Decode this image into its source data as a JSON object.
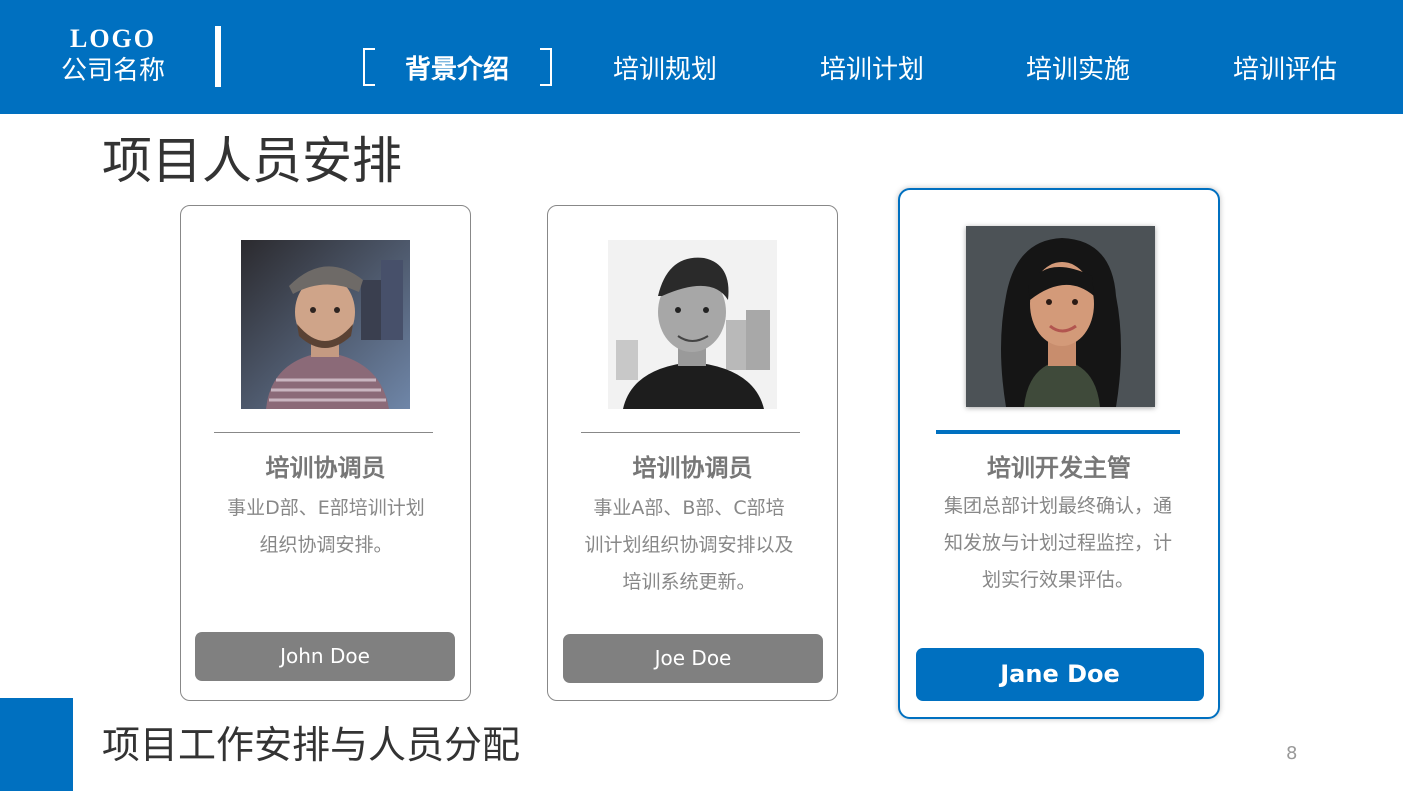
{
  "header": {
    "logo": "LOGO",
    "company_name": "公司名称",
    "nav": [
      {
        "label": "背景介绍",
        "active": true
      },
      {
        "label": "培训规划",
        "active": false
      },
      {
        "label": "培训计划",
        "active": false
      },
      {
        "label": "培训实施",
        "active": false
      },
      {
        "label": "培训评估",
        "active": false
      }
    ]
  },
  "section_title": "项目人员安排",
  "cards": [
    {
      "role": "培训协调员",
      "description": "事业D部、E部培训计划组织协调安排。",
      "name": "John Doe",
      "highlighted": false
    },
    {
      "role": "培训协调员",
      "description": "事业A部、B部、C部培训计划组织协调安排以及培训系统更新。",
      "name": "Joe Doe",
      "highlighted": false
    },
    {
      "role": "培训开发主管",
      "description": "集团总部计划最终确认，通知发放与计划过程监控，计划实行效果评估。",
      "name": "Jane Doe",
      "highlighted": true
    }
  ],
  "footer_title": "项目工作安排与人员分配",
  "page_number": "8",
  "colors": {
    "brand_blue": "#0070c0",
    "name_button_gray": "#808080",
    "text_gray": "#777777"
  }
}
